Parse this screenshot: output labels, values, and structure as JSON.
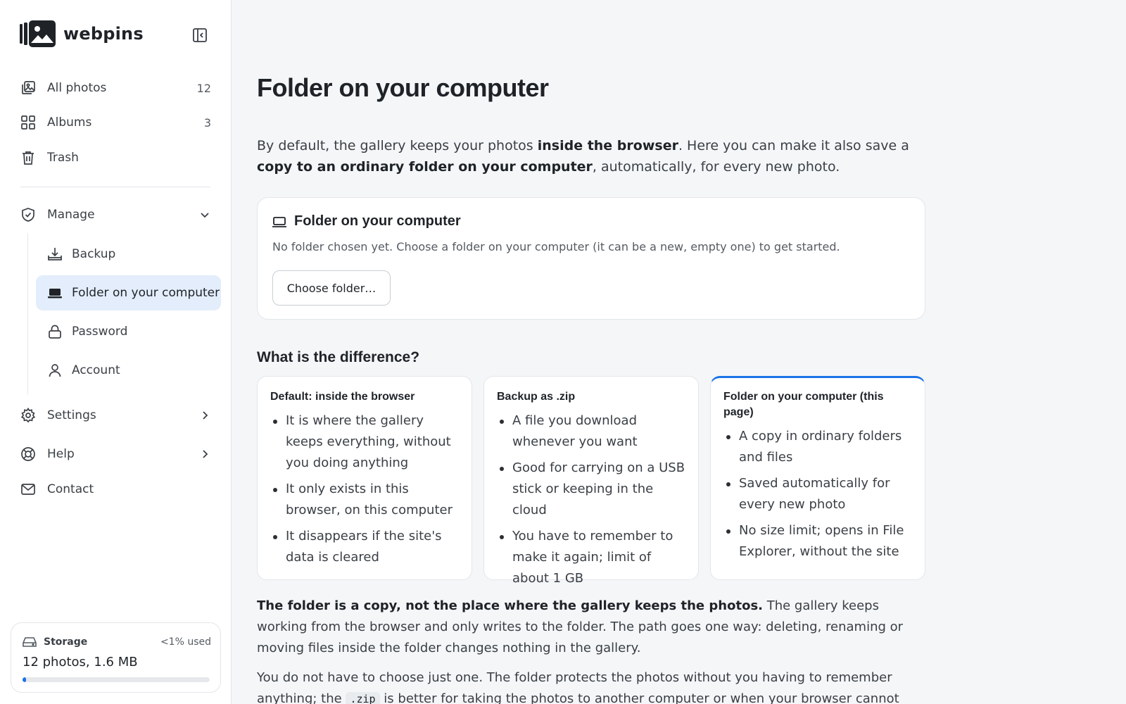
{
  "app": {
    "name": "webpins",
    "accent_color": "#1a73e8"
  },
  "sidebar": {
    "collapse_icon": "sidebar-collapse-icon",
    "items": [
      {
        "label": "All photos",
        "count": "12",
        "icon": "photos-icon"
      },
      {
        "label": "Albums",
        "count": "3",
        "icon": "grid-icon"
      },
      {
        "label": "Trash",
        "icon": "trash-icon"
      }
    ],
    "manage": {
      "label": "Manage",
      "icon": "shield-check-icon",
      "expanded": true,
      "children": [
        {
          "label": "Backup",
          "icon": "download-tray-icon"
        },
        {
          "label": "Folder on your computer",
          "icon": "laptop-icon",
          "active": true
        },
        {
          "label": "Password",
          "icon": "lock-icon"
        },
        {
          "label": "Account",
          "icon": "user-icon"
        }
      ]
    },
    "bottom_items": [
      {
        "label": "Settings",
        "icon": "gear-icon"
      },
      {
        "label": "Help",
        "icon": "lifebuoy-icon"
      },
      {
        "label": "Contact",
        "icon": "mail-icon"
      }
    ],
    "storage": {
      "label": "Storage",
      "used": "<1% used",
      "total": "12 photos, 1.6 MB",
      "fill_fraction": 0.01
    }
  },
  "main": {
    "title": "Folder on your computer",
    "intro": {
      "t1": "By default, the gallery keeps your photos ",
      "b1": "inside the browser",
      "t2": ". Here you can make it also save a ",
      "b2": "copy to an ordinary folder on your computer",
      "t3": ", automatically, for every new photo."
    },
    "folder_card": {
      "title": "Folder on your computer",
      "description": "No folder chosen yet. Choose a folder on your computer (it can be a new, empty one) to get started.",
      "button": "Choose folder…"
    },
    "difference": {
      "title": "What is the difference?",
      "cards": [
        {
          "title": "Default: inside the browser",
          "points": [
            "It is where the gallery keeps everything, without you doing anything",
            "It only exists in this browser, on this computer",
            "It disappears if the site's data is cleared"
          ]
        },
        {
          "title": "Backup as .zip",
          "points": [
            "A file you download whenever you want",
            "Good for carrying on a USB stick or keeping in the cloud",
            "You have to remember to make it again; limit of about 1 GB"
          ]
        },
        {
          "title": "Folder on your computer (this page)",
          "points": [
            "A copy in ordinary folders and files",
            "Saved automatically for every new photo",
            "No size limit; opens in File Explorer, without the site"
          ]
        }
      ]
    },
    "para1": {
      "bold": "The folder is a copy, not the place where the gallery keeps the photos.",
      "rest": " The gallery keeps working from the browser and only writes to the folder. The path goes one way: deleting, renaming or moving files inside the folder changes nothing in the gallery."
    },
    "para2": {
      "t1": "You do not have to choose just one. The folder protects the photos without you having to remember anything; the ",
      "code": ".zip",
      "t2": " is better for taking the photos to another computer or when your browser cannot write to folders. Using"
    }
  }
}
